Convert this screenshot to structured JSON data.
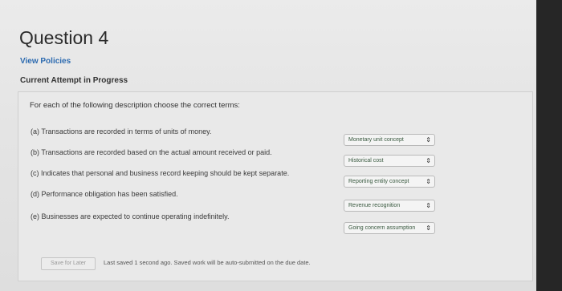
{
  "header": {
    "title": "Question 4",
    "policies_link": "View Policies",
    "attempt_status": "Current Attempt in Progress"
  },
  "question": {
    "instruction": "For each of the following description choose the correct terms:",
    "items": [
      {
        "text": "(a)  Transactions are recorded in terms of units of money.",
        "answer": "Monetary unit concept"
      },
      {
        "text": "(b)  Transactions are recorded based on the actual amount received or paid.",
        "answer": "Historical cost"
      },
      {
        "text": "(c)  Indicates that personal and business record keeping should be kept separate.",
        "answer": "Reporting entity concept"
      },
      {
        "text": "(d)  Performance obligation has been satisfied.",
        "answer": "Revenue recognition"
      },
      {
        "text": "(e)  Businesses are expected to continue operating indefinitely.",
        "answer": "Going concern assumption"
      }
    ]
  },
  "footer": {
    "save_label": "Save for Later",
    "status_text": "Last saved 1 second ago.  Saved work will be auto-submitted on the due date."
  },
  "icons": {
    "select_caret": "up-down-caret-icon"
  },
  "colors": {
    "link": "#2d6bb0",
    "answer_text": "#3a5a40"
  }
}
